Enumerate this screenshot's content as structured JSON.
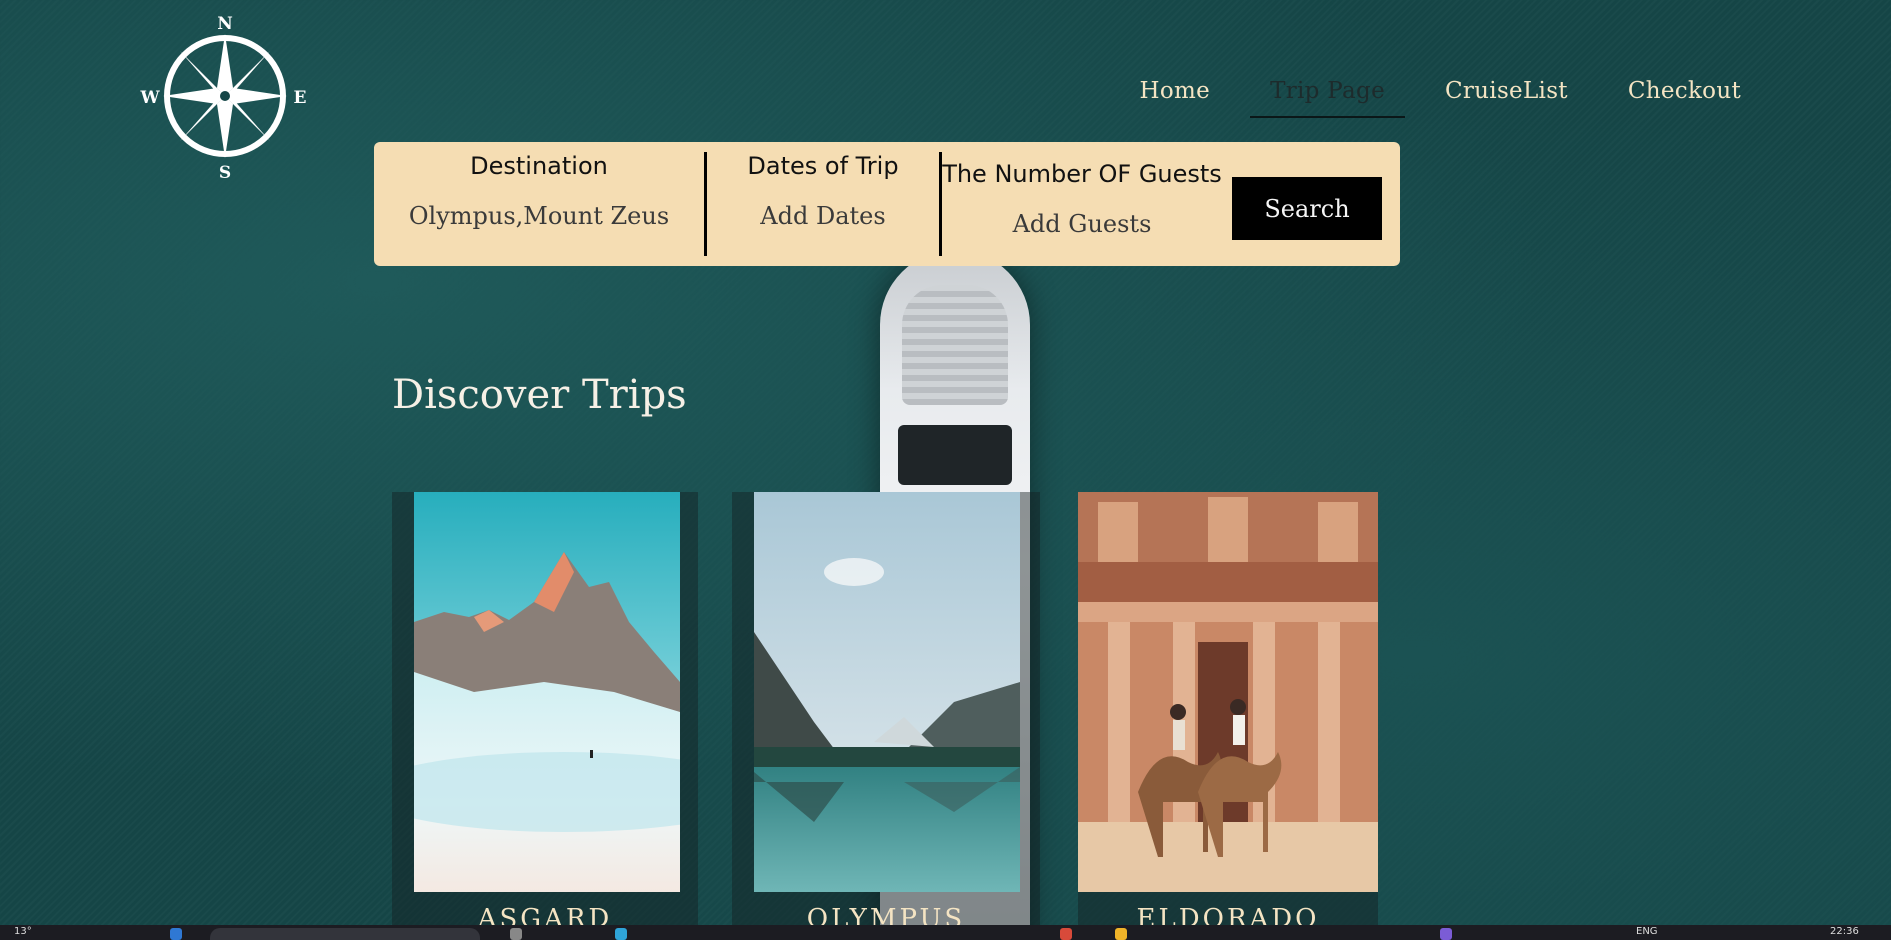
{
  "logo": {
    "north": "N",
    "south": "S",
    "east": "E",
    "west": "W",
    "icon": "compass-rose-icon"
  },
  "nav": {
    "items": [
      {
        "label": "Home",
        "active": false
      },
      {
        "label": "Trip Page",
        "active": true
      },
      {
        "label": "CruiseList",
        "active": false
      },
      {
        "label": "Checkout",
        "active": false
      }
    ]
  },
  "search": {
    "destination_label": "Destination",
    "destination_value": "Olympus,Mount Zeus",
    "dates_label": "Dates of Trip",
    "dates_placeholder": "Add Dates",
    "guests_label": "The Number OF Guests",
    "guests_placeholder": "Add Guests",
    "button_label": "Search"
  },
  "discover": {
    "title": "Discover Trips",
    "cards": [
      {
        "name": "ASGARD",
        "image": "snowy-mountain-photo"
      },
      {
        "name": "OLYMPUS",
        "image": "mountain-lake-photo"
      },
      {
        "name": "ELDORADO",
        "image": "petra-camels-photo"
      }
    ]
  },
  "taskbar": {
    "weather": "13°",
    "language": "ENG",
    "time": "22:36"
  },
  "colors": {
    "background": "#154647",
    "search_bar": "#f5ddb3",
    "nav_text": "#f4e4c3",
    "button": "#000000"
  }
}
